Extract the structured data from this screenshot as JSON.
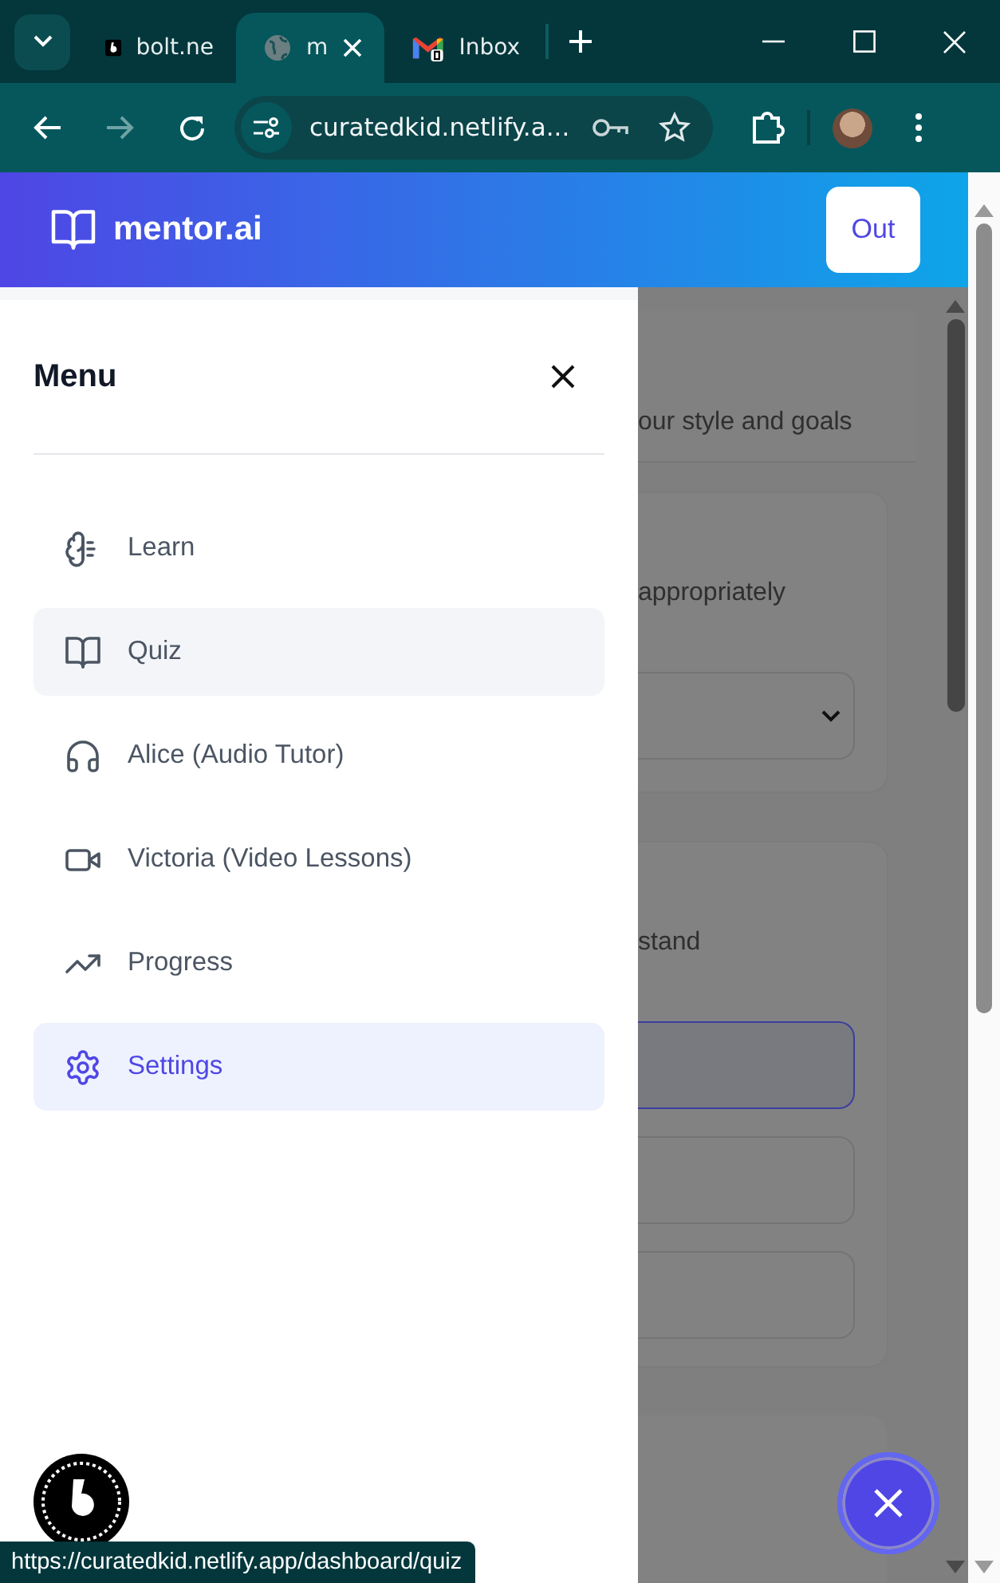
{
  "browser": {
    "tabs": [
      {
        "title": "bolt.ne",
        "kind": "bolt",
        "selected": false
      },
      {
        "title": "m",
        "kind": "globe",
        "selected": true
      },
      {
        "title": "Inbox",
        "kind": "mail",
        "selected": false
      }
    ],
    "address": "curatedkid.netlify.a...",
    "status_url": "https://curatedkid.netlify.app/dashboard/quiz"
  },
  "header": {
    "brand": "mentor.ai",
    "button": "Out"
  },
  "menu": {
    "title": "Menu",
    "items": [
      {
        "label": "Learn",
        "kind": "brain",
        "selected": false,
        "hovered": false
      },
      {
        "label": "Quiz",
        "kind": "book",
        "selected": false,
        "hovered": true
      },
      {
        "label": "Alice (Audio Tutor)",
        "kind": "headphones",
        "selected": false,
        "hovered": false
      },
      {
        "label": "Victoria (Video Lessons)",
        "kind": "video",
        "selected": false,
        "hovered": false
      },
      {
        "label": "Progress",
        "kind": "trend",
        "selected": false,
        "hovered": false
      },
      {
        "label": "Settings",
        "kind": "gear",
        "selected": true,
        "hovered": false
      }
    ]
  },
  "background": {
    "intro": "our style and goals",
    "cards": [
      {
        "text": "appropriately",
        "fields": [
          {
            "kind": "select",
            "selected": false
          }
        ]
      },
      {
        "text": "stand",
        "fields": [
          {
            "kind": "option",
            "selected": true
          },
          {
            "kind": "option",
            "selected": false
          },
          {
            "kind": "option",
            "selected": false
          }
        ]
      }
    ]
  }
}
